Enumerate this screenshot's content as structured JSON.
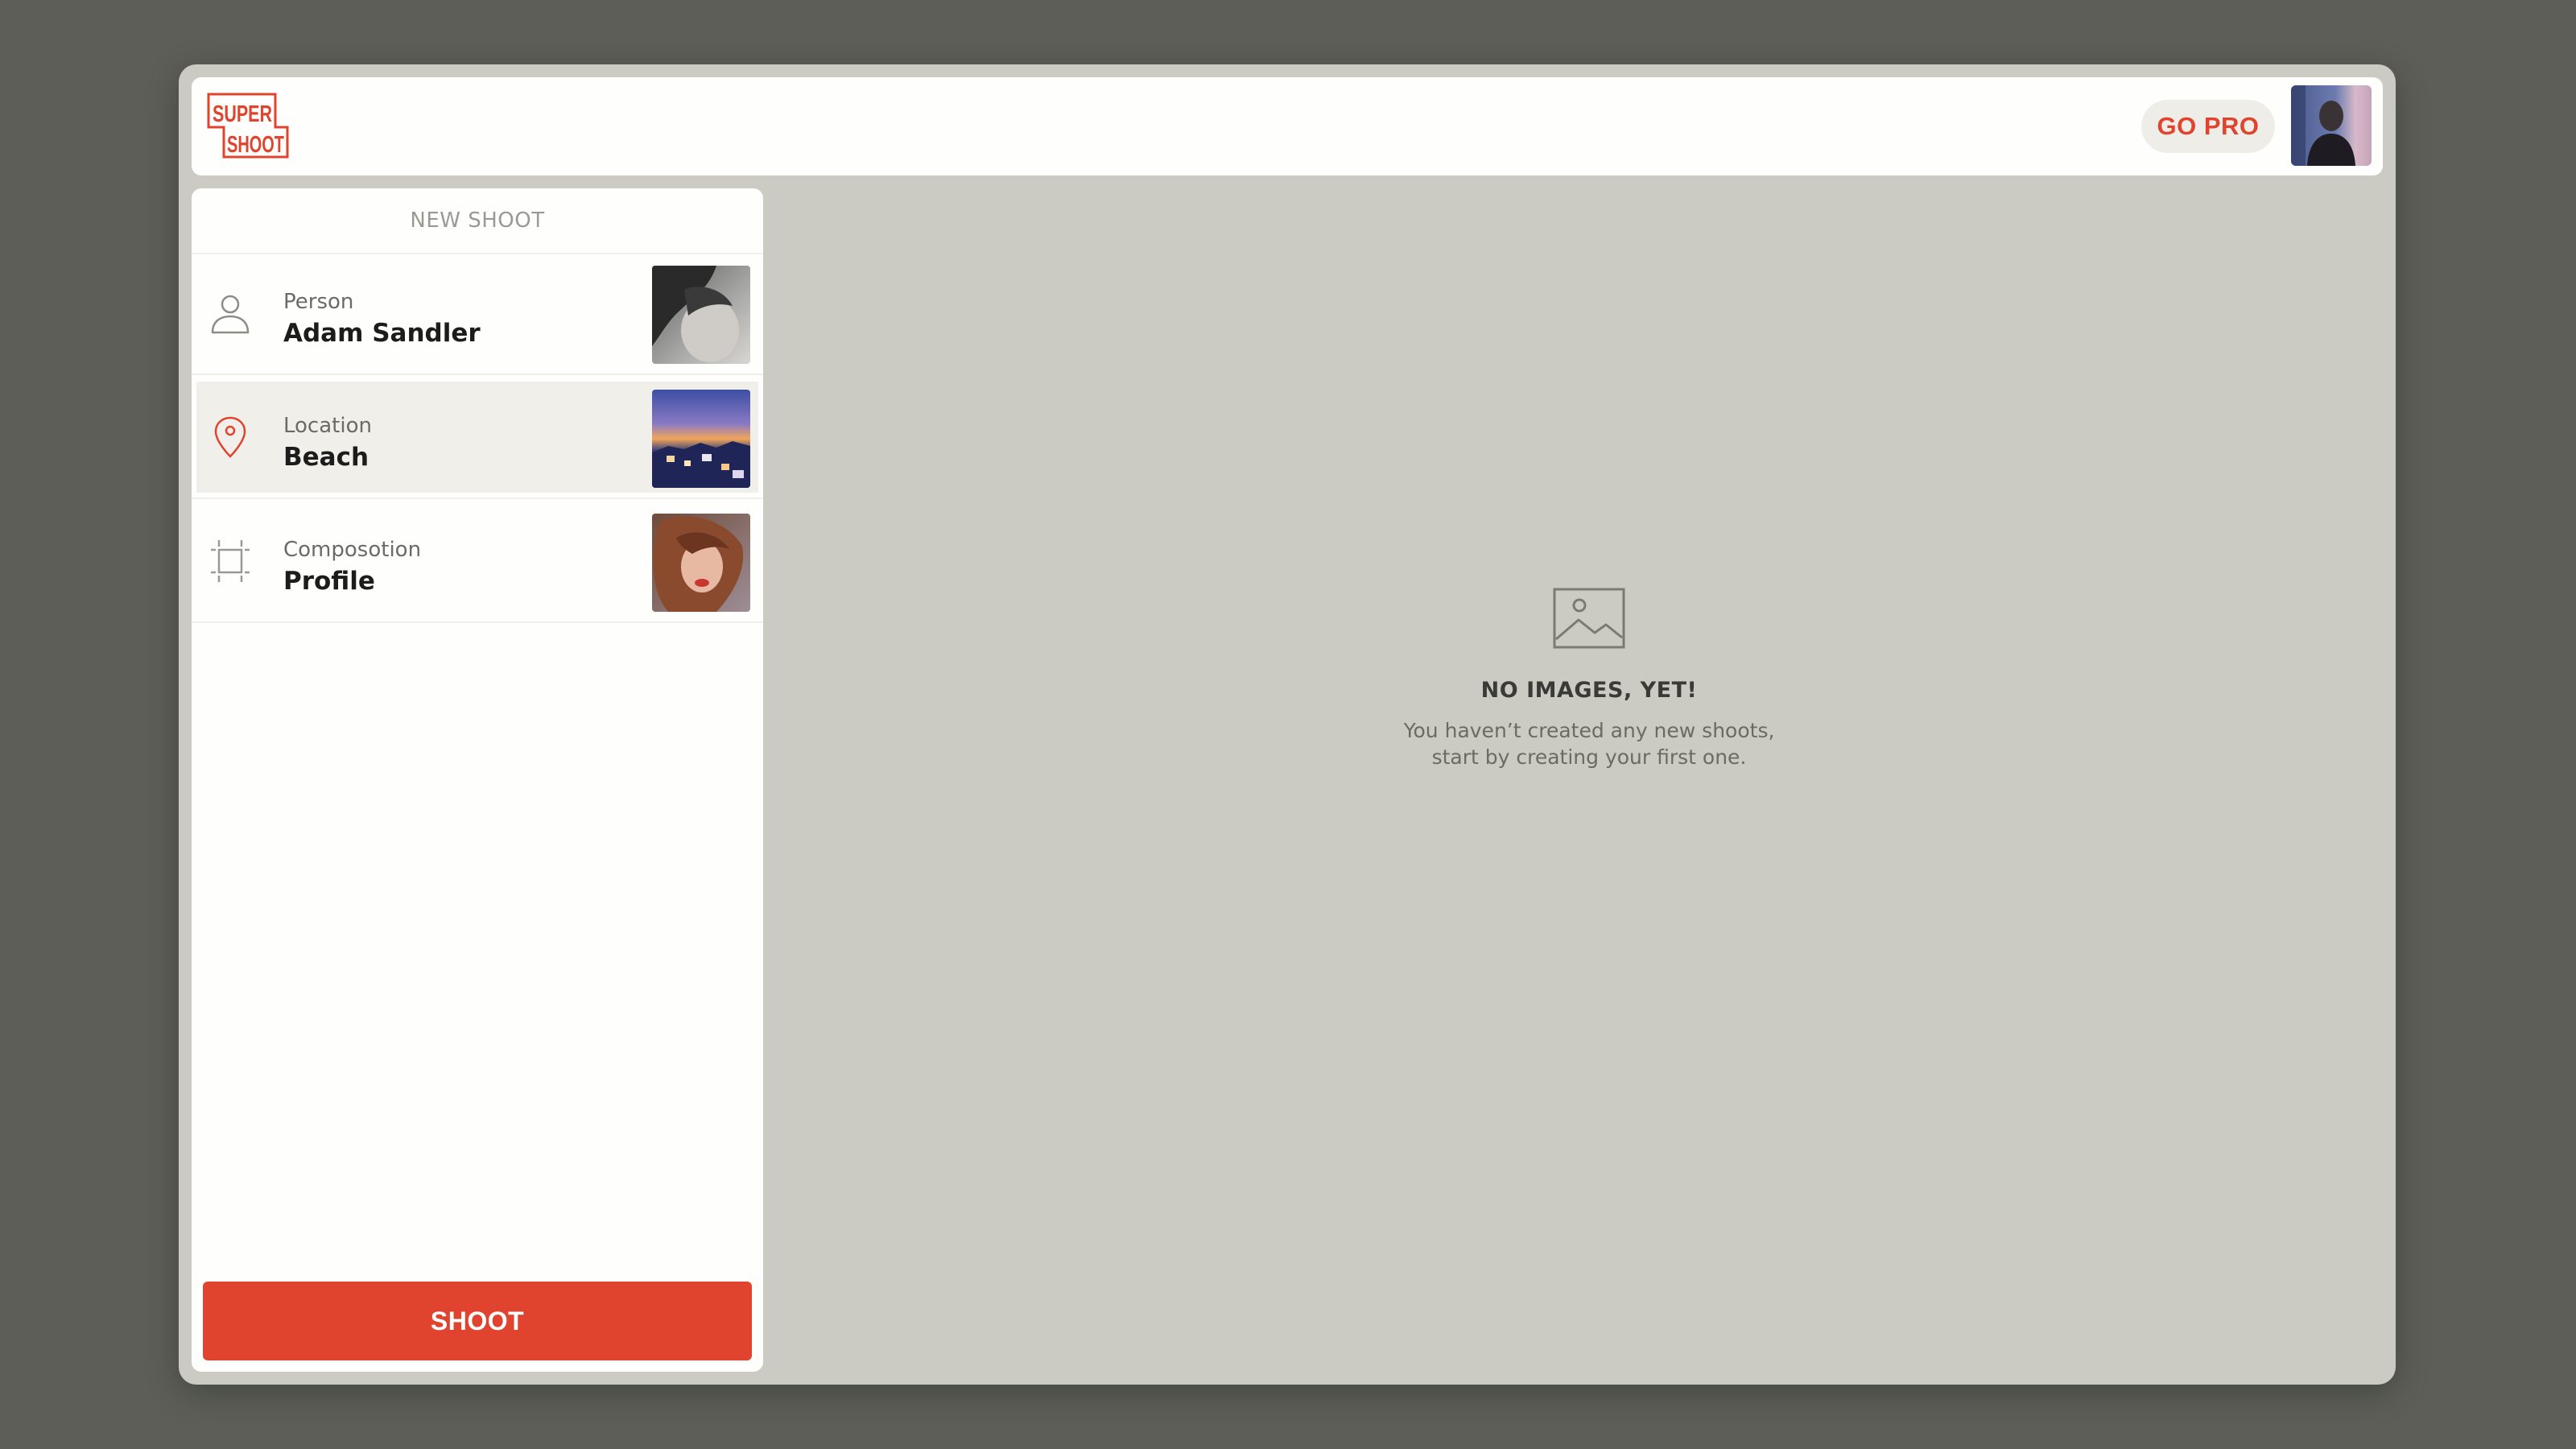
{
  "header": {
    "logo_text_top": "SUPER",
    "logo_text_bottom": "SHOOT",
    "go_pro_label": "GO PRO",
    "accent_color": "#e0442e"
  },
  "sidebar": {
    "title": "NEW SHOOT",
    "items": [
      {
        "label": "Person",
        "value": "Adam Sandler",
        "icon": "person-icon",
        "selected": false
      },
      {
        "label": "Location",
        "value": "Beach",
        "icon": "location-pin-icon",
        "selected": true
      },
      {
        "label": "Composotion",
        "value": "Profile",
        "icon": "crop-frame-icon",
        "selected": false
      }
    ],
    "shoot_button_label": "SHOOT"
  },
  "empty_state": {
    "icon": "image-icon",
    "title": "NO IMAGES, YET!",
    "line1": "You haven’t created any new shoots,",
    "line2": "start by creating your first one."
  }
}
